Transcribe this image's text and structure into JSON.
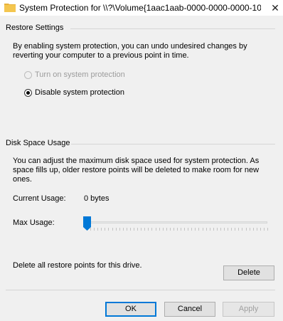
{
  "window": {
    "title": "System Protection for \\\\?\\Volume{1aac1aab-0000-0000-0000-10...",
    "close_glyph": "✕"
  },
  "restore_settings": {
    "group_title": "Restore Settings",
    "description": "By enabling system protection, you can undo undesired changes by reverting your computer to a previous point in time.",
    "options": [
      {
        "label": "Turn on system protection",
        "checked": false,
        "enabled": false
      },
      {
        "label": "Disable system protection",
        "checked": true,
        "enabled": true
      }
    ]
  },
  "disk_space": {
    "group_title": "Disk Space Usage",
    "description": "You can adjust the maximum disk space used for system protection. As space fills up, older restore points will be deleted to make room for new ones.",
    "current_usage_label": "Current Usage:",
    "current_usage_value": "0 bytes",
    "max_usage_label": "Max Usage:",
    "max_usage_fraction": 0
  },
  "delete_section": {
    "text": "Delete all restore points for this drive.",
    "delete_label": "Delete"
  },
  "footer": {
    "ok_label": "OK",
    "cancel_label": "Cancel",
    "apply_label": "Apply"
  },
  "colors": {
    "folder_icon": "#f4c64f",
    "slider_thumb": "#0078d7",
    "default_button_border": "#0078d7"
  }
}
